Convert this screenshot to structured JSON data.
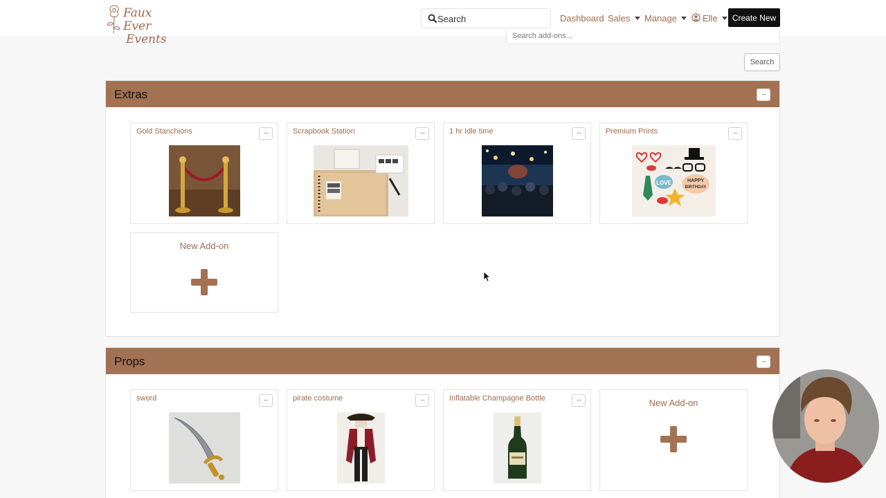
{
  "brand": {
    "logo_line1": "Faux Ever",
    "logo_line2": "Events"
  },
  "nav": {
    "search_placeholder": "Search",
    "dashboard": "Dashboard",
    "sales": "Sales",
    "manage": "Manage",
    "user": "Elle",
    "create_new": "Create New"
  },
  "addons_search": {
    "placeholder": "Search add-ons...",
    "button": "Search"
  },
  "sections": [
    {
      "title": "Extras",
      "menu": "···",
      "cards": [
        {
          "name": "Gold Stanchions",
          "image": "gold-stanchions-photo"
        },
        {
          "name": "Scrapbook Station",
          "image": "scrapbook-guestbook-photo"
        },
        {
          "name": "1 hr Idle time",
          "image": "concert-crowd-photo"
        },
        {
          "name": "Premium Prints",
          "image": "photo-booth-props-photo",
          "props": {
            "love": "LOVE",
            "happy": "HAPPY",
            "birthday": "BIRTHDAY"
          }
        }
      ],
      "new_addon": "New Add-on"
    },
    {
      "title": "Props",
      "menu": "···",
      "cards": [
        {
          "name": "sword",
          "image": "toy-sword-photo"
        },
        {
          "name": "pirate costume",
          "image": "pirate-costume-photo"
        },
        {
          "name": "Inflatable Champagne Bottle",
          "image": "champagne-bottle-photo"
        }
      ],
      "new_addon": "New Add-on"
    }
  ],
  "card_menu": "···",
  "colors": {
    "accent": "#a27253",
    "link": "#9c6b4e",
    "button_dark": "#111111"
  }
}
